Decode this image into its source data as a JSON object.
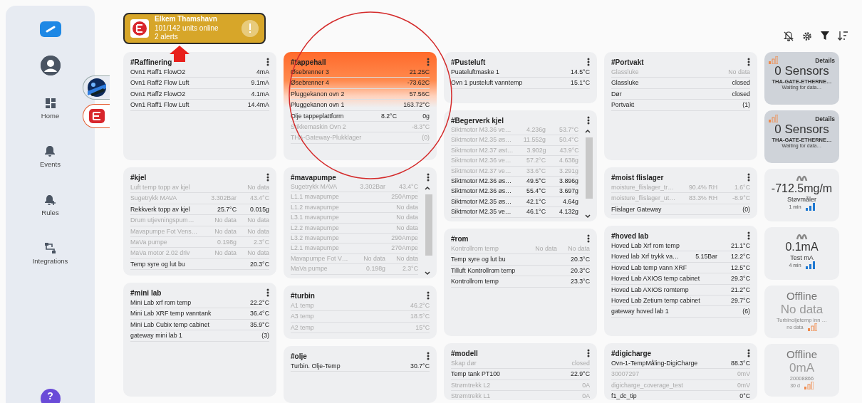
{
  "sidebar": {
    "items": [
      {
        "label": "Home"
      },
      {
        "label": "Events"
      },
      {
        "label": "Rules"
      },
      {
        "label": "Integrations"
      }
    ],
    "help": "?"
  },
  "devices": [
    {
      "kind": "picture",
      "selected": false
    },
    {
      "kind": "logo",
      "selected": true
    }
  ],
  "site": {
    "name": "Elkem Thamshavn",
    "units": "101/142 units online",
    "alerts": "2 alerts",
    "alert": true
  },
  "columns": [
    [
      {
        "title": "#Raffinering",
        "alert": false,
        "scroll": false,
        "rows": [
          {
            "name": "Ovn1 Raff1 FlowO2",
            "values": [
              "4mA"
            ],
            "dim": false
          },
          {
            "name": "Ovn1 Raff2 Flow Luft",
            "values": [
              "9.1mA"
            ],
            "dim": false
          },
          {
            "name": "Ovn1 Raff2 FlowO2",
            "values": [
              "4.1mA"
            ],
            "dim": false
          },
          {
            "name": "Ovn1 Raff1 Flow Luft",
            "values": [
              "14.4mA"
            ],
            "dim": false
          }
        ]
      },
      {
        "title": "#kjel",
        "alert": false,
        "scroll": false,
        "rows": [
          {
            "name": "Luft temp topp av kjel",
            "values": [
              "No data"
            ],
            "dim": true
          },
          {
            "name": "Sugetrykk MAVA",
            "values": [
              "3.302Bar",
              "43.4°C"
            ],
            "dim": true
          },
          {
            "name": "Rekkverk topp av kjel",
            "values": [
              "25.7°C",
              "0.015g"
            ],
            "dim": false
          },
          {
            "name": "Drum utjevningspum…",
            "values": [
              "No data",
              "No data"
            ],
            "dim": true
          },
          {
            "name": "Mavapumpe Fot Vens…",
            "values": [
              "No data",
              "No data"
            ],
            "dim": true
          },
          {
            "name": "MaVa pumpe",
            "values": [
              "0.198g",
              "2.3°C"
            ],
            "dim": true
          },
          {
            "name": "MaVa motor 2.02 driv",
            "values": [
              "No data",
              "No data"
            ],
            "dim": true
          },
          {
            "name": "Temp syre og lut bu",
            "values": [
              "20.3°C"
            ],
            "dim": false
          }
        ]
      },
      {
        "title": "#mini lab",
        "alert": false,
        "scroll": false,
        "rows": [
          {
            "name": "Mini Lab xrf rom temp",
            "values": [
              "22.2°C"
            ],
            "dim": false
          },
          {
            "name": "Mini Lab XRF temp vanntank",
            "values": [
              "36.4°C"
            ],
            "dim": false
          },
          {
            "name": "Mini Lab Cubix temp cabinet",
            "values": [
              "35.9°C"
            ],
            "dim": false
          },
          {
            "name": "gateway mini lab 1",
            "values": [
              "(3)"
            ],
            "dim": false
          }
        ]
      }
    ],
    [
      {
        "title": "#tappehall",
        "alert": true,
        "scroll": false,
        "rows": [
          {
            "name": "Øsebrenner 3",
            "values": [
              "21.25C"
            ],
            "dim": false
          },
          {
            "name": "Øsebrenner 4",
            "values": [
              "-73.62C"
            ],
            "dim": false
          },
          {
            "name": "Pluggekanon ovn 2",
            "values": [
              "57.56C"
            ],
            "dim": false
          },
          {
            "name": "Pluggekanon ovn 1",
            "values": [
              "163.72°C"
            ],
            "dim": false
          },
          {
            "name": "Olje tappeplattform",
            "values": [
              "8.2°C",
              "0g"
            ],
            "dim": false
          },
          {
            "name": "Stikkemaskin Ovn 2",
            "values": [
              "-8.3°C"
            ],
            "dim": true
          },
          {
            "name": "THA-Gateway-Plukklager",
            "values": [
              "(0)"
            ],
            "dim": true
          }
        ]
      },
      {
        "title": "#mavapumpe",
        "alert": false,
        "scroll": true,
        "rows": [
          {
            "name": "Sugetrykk MAVA",
            "values": [
              "3.302Bar",
              "43.4°C"
            ],
            "dim": true
          },
          {
            "name": "L1.1 mavapumpe",
            "values": [
              "250Ampe"
            ],
            "dim": true
          },
          {
            "name": "L1.2 mavapumpe",
            "values": [
              "No data"
            ],
            "dim": true
          },
          {
            "name": "L3.1 mavapumpe",
            "values": [
              "No data"
            ],
            "dim": true
          },
          {
            "name": "L2.2 mavapumpe",
            "values": [
              "No data"
            ],
            "dim": true
          },
          {
            "name": "L3.2 mavapumpe",
            "values": [
              "290Ampe"
            ],
            "dim": true
          },
          {
            "name": "L2.1 mavapumpe",
            "values": [
              "270Ampe"
            ],
            "dim": true
          },
          {
            "name": "Mavapumpe Fot V…",
            "values": [
              "No data",
              "No data"
            ],
            "dim": true
          },
          {
            "name": "MaVa pumpe",
            "values": [
              "0.198g",
              "2.3°C"
            ],
            "dim": true
          }
        ]
      },
      {
        "title": "#turbin",
        "alert": false,
        "scroll": false,
        "rows": [
          {
            "name": "A1 temp",
            "values": [
              "46.2°C"
            ],
            "dim": true
          },
          {
            "name": "A3 temp",
            "values": [
              "18.5°C"
            ],
            "dim": true
          },
          {
            "name": "A2 temp",
            "values": [
              "15°C"
            ],
            "dim": true
          }
        ]
      },
      {
        "title": "#olje",
        "alert": false,
        "scroll": false,
        "rows": [
          {
            "name": "Turbin. Olje-Temp",
            "values": [
              "30.7°C"
            ],
            "dim": false
          }
        ]
      }
    ],
    [
      {
        "title": "#Pusteluft",
        "alert": false,
        "scroll": false,
        "rows": [
          {
            "name": "Puateluftmaske 1",
            "values": [
              "14.5°C"
            ],
            "dim": false
          },
          {
            "name": "Ovn 1 pusteluft vanntemp",
            "values": [
              "15.1°C"
            ],
            "dim": false
          }
        ]
      },
      {
        "title": "#Begerverk kjel",
        "alert": false,
        "scroll": true,
        "rows": [
          {
            "name": "Siktmotor M3.36 ve…",
            "values": [
              "4.236g",
              "53.7°C"
            ],
            "dim": true
          },
          {
            "name": "Siktmotor M2.35 øs…",
            "values": [
              "11.552g",
              "50.4°C"
            ],
            "dim": true
          },
          {
            "name": "Siktmotor M2.37 øst…",
            "values": [
              "3.902g",
              "43.9°C"
            ],
            "dim": true
          },
          {
            "name": "Siktmotor M2.36 ve…",
            "values": [
              "57.2°C",
              "4.638g"
            ],
            "dim": true
          },
          {
            "name": "Siktmotor M2.37 ve…",
            "values": [
              "33.6°C",
              "3.291g"
            ],
            "dim": true
          },
          {
            "name": "Siktmotor M2.36 øs…",
            "values": [
              "49.5°C",
              "3.896g"
            ],
            "dim": false
          },
          {
            "name": "Siktmotor M2.36 øs…",
            "values": [
              "55.4°C",
              "3.697g"
            ],
            "dim": false
          },
          {
            "name": "Siktmotor M2.35 øs…",
            "values": [
              "42.1°C",
              "4.64g"
            ],
            "dim": false
          },
          {
            "name": "Siktmotor M2.35 ve…",
            "values": [
              "46.1°C",
              "4.132g"
            ],
            "dim": false
          }
        ]
      },
      {
        "title": "#rom",
        "alert": false,
        "scroll": false,
        "rows": [
          {
            "name": "Kontrollrom temp",
            "values": [
              "No data",
              "No data"
            ],
            "dim": true
          },
          {
            "name": "Temp syre og lut bu",
            "values": [
              "20.3°C"
            ],
            "dim": false
          },
          {
            "name": "Tilluft Kontrollrom temp",
            "values": [
              "20.3°C"
            ],
            "dim": false
          },
          {
            "name": "Kontrollrom temp",
            "values": [
              "23.3°C"
            ],
            "dim": false
          }
        ]
      },
      {
        "title": "#modell",
        "alert": false,
        "scroll": false,
        "rows": [
          {
            "name": "Skap dør",
            "values": [
              "closed"
            ],
            "dim": true
          },
          {
            "name": "Temp tank PT100",
            "values": [
              "22.9°C"
            ],
            "dim": false
          },
          {
            "name": "Strømtrekk L2",
            "values": [
              "0A"
            ],
            "dim": true
          },
          {
            "name": "Strømtrekk L1",
            "values": [
              "0A"
            ],
            "dim": true
          }
        ]
      }
    ],
    [
      {
        "title": "#Portvakt",
        "alert": false,
        "scroll": false,
        "rows": [
          {
            "name": "Glassluke",
            "values": [
              "No data"
            ],
            "dim": true
          },
          {
            "name": "Glassluke",
            "values": [
              "closed"
            ],
            "dim": false
          },
          {
            "name": "Dør",
            "values": [
              "closed"
            ],
            "dim": false
          },
          {
            "name": "Portvakt",
            "values": [
              "(1)"
            ],
            "dim": false
          }
        ]
      },
      {
        "title": "#moist flislager",
        "alert": false,
        "scroll": false,
        "rows": [
          {
            "name": "moisture_flislager_tr…",
            "values": [
              "90.4% RH",
              "1.6°C"
            ],
            "dim": true
          },
          {
            "name": "moisture_flislager_ut…",
            "values": [
              "83.3% RH",
              "-8.9°C"
            ],
            "dim": true
          },
          {
            "name": "Flislager Gateway",
            "values": [
              "(0)"
            ],
            "dim": false
          }
        ]
      },
      {
        "title": "#hoved lab",
        "alert": false,
        "scroll": false,
        "rows": [
          {
            "name": "Hoved Lab Xrf rom temp",
            "values": [
              "21.1°C"
            ],
            "dim": false
          },
          {
            "name": "Hoved lab Xrf trykk va…",
            "values": [
              "5.15Bar",
              "12.2°C"
            ],
            "dim": false
          },
          {
            "name": "Hoved Lab temp vann XRF",
            "values": [
              "12.5°C"
            ],
            "dim": false
          },
          {
            "name": "Hoved Lab AXIOS temp cabinet",
            "values": [
              "29.3°C"
            ],
            "dim": false
          },
          {
            "name": "Hoved Lab AXIOS romtemp",
            "values": [
              "21.2°C"
            ],
            "dim": false
          },
          {
            "name": "Hoved Lab Zetium temp cabinet",
            "values": [
              "29.7°C"
            ],
            "dim": false
          },
          {
            "name": "gateway hoved lab 1",
            "values": [
              "(6)"
            ],
            "dim": false
          }
        ]
      },
      {
        "title": "#digicharge",
        "alert": false,
        "scroll": false,
        "rows": [
          {
            "name": "Ovn-1-TempMåling-DigiCharge",
            "values": [
              "88.3°C"
            ],
            "dim": false
          },
          {
            "name": "30007297",
            "values": [
              "0mV"
            ],
            "dim": true
          },
          {
            "name": "digicharge_coverage_test",
            "values": [
              "0mV"
            ],
            "dim": true
          },
          {
            "name": "f1_dc_tip",
            "values": [
              "0°C"
            ],
            "dim": false
          }
        ]
      }
    ]
  ],
  "tiles": [
    {
      "kind": "sensors",
      "link": "Details",
      "value": "0 Sensors",
      "name": "THA-GATE-ETHERNE…",
      "status": "Waiting for data…"
    },
    {
      "kind": "sensors",
      "link": "Details",
      "value": "0 Sensors",
      "name": "THA-GATE-ETHERNE…",
      "status": "Waiting for data…"
    },
    {
      "kind": "reading",
      "value": "-712.5mg/m",
      "name": "Støvmåler",
      "time": "1 min",
      "online": true
    },
    {
      "kind": "reading",
      "value": "0.1mA",
      "name": "Test mA",
      "time": "4 min",
      "online": true
    },
    {
      "kind": "offline",
      "status": "Offline",
      "value": "No data",
      "name": "Turbinoljetemp inn …",
      "time": "no data",
      "online": false
    },
    {
      "kind": "offline",
      "status": "Offline",
      "value": "0mA",
      "name": "20008866",
      "time": "30 d",
      "online": false
    }
  ],
  "annotations": {
    "highlight_circle": true,
    "pointer_arrow": true
  }
}
